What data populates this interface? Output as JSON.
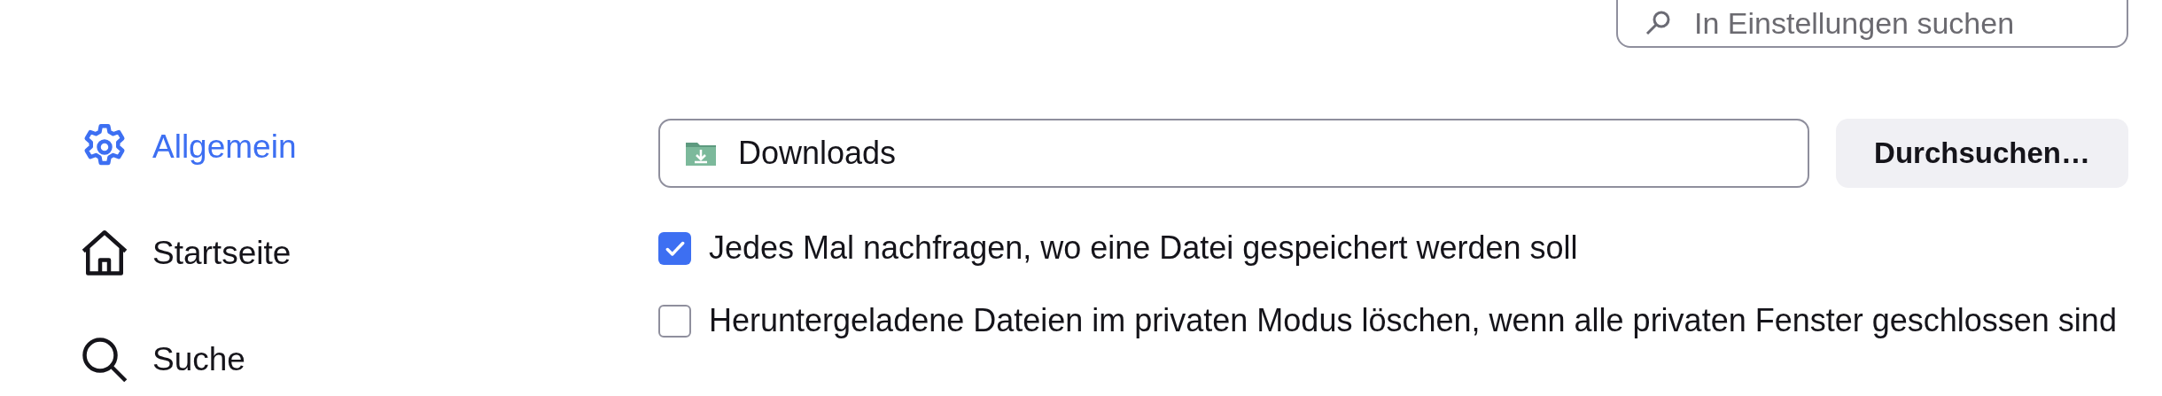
{
  "search": {
    "placeholder": "In Einstellungen suchen"
  },
  "sidebar": {
    "items": [
      {
        "kind": "gear",
        "label": "Allgemein",
        "selected": true
      },
      {
        "kind": "home",
        "label": "Startseite",
        "selected": false
      },
      {
        "kind": "search",
        "label": "Suche",
        "selected": false
      }
    ]
  },
  "downloads": {
    "folder": "Downloads",
    "browse_button": "Durchsuchen…"
  },
  "options": [
    {
      "label": "Jedes Mal nachfragen, wo eine Datei gespeichert werden soll",
      "checked": true
    },
    {
      "label": "Heruntergeladene Dateien im privaten Modus löschen, wenn alle privaten Fenster geschlossen sind",
      "checked": false
    }
  ]
}
